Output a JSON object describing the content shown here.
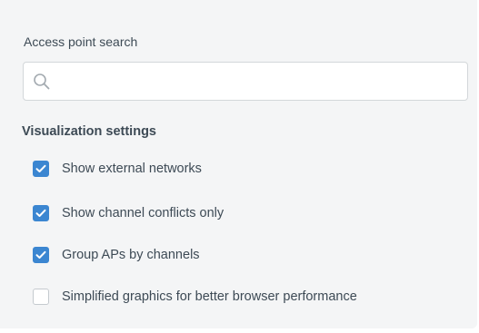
{
  "search": {
    "label": "Access point search",
    "value": "",
    "placeholder": "",
    "icon": "search-icon"
  },
  "visualization": {
    "title": "Visualization settings",
    "accent_color": "#3b86d1",
    "options": [
      {
        "label": "Show external networks",
        "checked": true
      },
      {
        "label": "Show channel conflicts only",
        "checked": true
      },
      {
        "label": "Group APs by channels",
        "checked": true
      },
      {
        "label": "Simplified graphics for better browser performance",
        "checked": false
      }
    ]
  }
}
